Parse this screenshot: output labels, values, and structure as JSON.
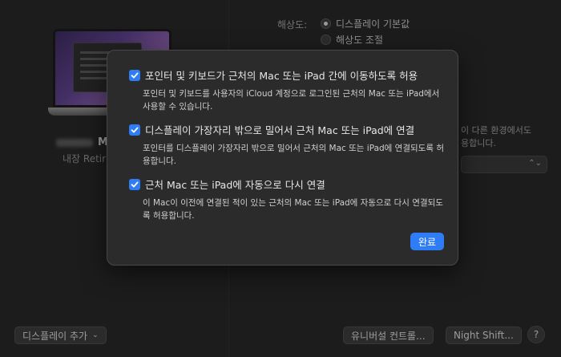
{
  "background": {
    "display_name_suffix": "M",
    "display_subtitle": "내장 Retir",
    "resolution_label": "해상도:",
    "resolution_options": [
      {
        "label": "디스플레이 기본값",
        "selected": true
      },
      {
        "label": "해상도 조절",
        "selected": false
      }
    ],
    "side_text_line1": "이 다른 환경에서도",
    "side_text_line2": "용합니다.",
    "add_display_label": "디스플레이 추가",
    "universal_control_label": "유니버설 컨트롤...",
    "night_shift_label": "Night Shift...",
    "help_label": "?"
  },
  "sheet": {
    "options": [
      {
        "checked": true,
        "title": "포인터 및 키보드가 근처의 Mac 또는 iPad 간에 이동하도록 허용",
        "description": "포인터 및 키보드를 사용자의 iCloud 계정으로 로그인된 근처의 Mac 또는 iPad에서 사용할 수 있습니다."
      },
      {
        "checked": true,
        "title": "디스플레이 가장자리 밖으로 밀어서 근처 Mac 또는 iPad에 연결",
        "description": "포인터를 디스플레이 가장자리 밖으로 밀어서 근처의 Mac 또는 iPad에 연결되도록 허용합니다."
      },
      {
        "checked": true,
        "title": "근처 Mac 또는 iPad에 자동으로 다시 연결",
        "description": "이 Mac이 이전에 연결된 적이 있는 근처의 Mac 또는 iPad에 자동으로 다시 연결되도록 허용합니다."
      }
    ],
    "done_label": "완료"
  },
  "colors": {
    "accent": "#2f7df6",
    "sheet_background": "#2b2b2b",
    "window_background": "#262626"
  },
  "icons": {
    "checkbox": "checkmark-icon",
    "popup_arrow": "chevron-updown-icon"
  }
}
